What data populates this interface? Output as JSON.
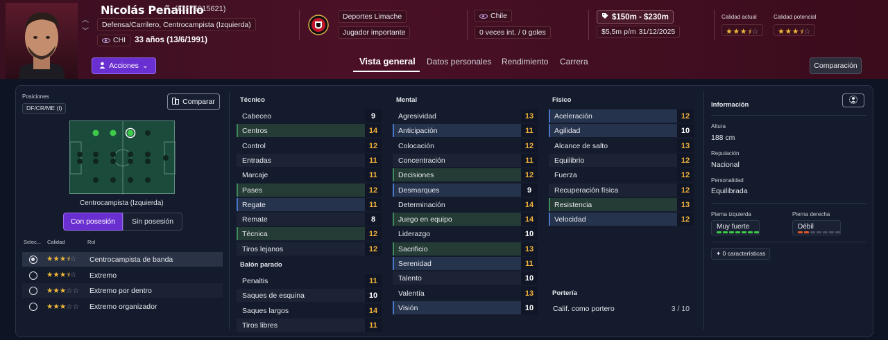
{
  "header": {
    "player_name": "Nicolás Peñailillo",
    "player_id": "(ID: 75015621)",
    "positions": "Defensa/Carrilero, Centrocampista (Izquierda)",
    "nation_code": "CHI",
    "age": "33 años (13/6/1991)",
    "actions_label": "Acciones",
    "club": "Deportes Limache",
    "squad_status": "Jugador importante",
    "nationality": "Chile",
    "caps": "0 veces int. / 0 goles",
    "value": "$150m - $230m",
    "wage": "$5,5m p/m",
    "contract_end": "31/12/2025",
    "current_ability_label": "Calidad actual",
    "current_ability_stars": "3.5",
    "potential_ability_label": "Calidad potencial",
    "potential_ability_stars": "3.5",
    "comparison_label": "Comparación"
  },
  "tabs": [
    {
      "label": "Vista general",
      "active": true
    },
    {
      "label": "Datos personales",
      "active": false
    },
    {
      "label": "Rendimiento",
      "active": false
    },
    {
      "label": "Carrera",
      "active": false
    }
  ],
  "positions_panel": {
    "label": "Posiciones",
    "position_code": "DF/CR/ME (I)",
    "compare_label": "Comparar",
    "pitch_caption": "Centrocampista (Izquierda)",
    "toggle_on": "Con posesión",
    "toggle_off": "Sin posesión",
    "role_headers": {
      "select": "Selec...",
      "quality": "Calidad",
      "role": "Rol"
    },
    "roles": [
      {
        "name": "Centrocampista de banda",
        "stars": 3.5,
        "selected": true
      },
      {
        "name": "Extremo",
        "stars": 3.5,
        "selected": false
      },
      {
        "name": "Extremo por dentro",
        "stars": 3,
        "selected": false
      },
      {
        "name": "Extremo organizador",
        "stars": 3,
        "selected": false
      }
    ]
  },
  "tecnico": {
    "title": "Técnico",
    "attrs": [
      {
        "name": "Cabeceo",
        "value": "9",
        "hl": "none"
      },
      {
        "name": "Centros",
        "value": "14",
        "hl": "green"
      },
      {
        "name": "Control",
        "value": "12",
        "hl": "none"
      },
      {
        "name": "Entradas",
        "value": "11",
        "hl": "none"
      },
      {
        "name": "Marcaje",
        "value": "11",
        "hl": "none"
      },
      {
        "name": "Pases",
        "value": "12",
        "hl": "green"
      },
      {
        "name": "Regate",
        "value": "11",
        "hl": "blue"
      },
      {
        "name": "Remate",
        "value": "8",
        "hl": "none"
      },
      {
        "name": "Técnica",
        "value": "12",
        "hl": "green"
      },
      {
        "name": "Tiros lejanos",
        "value": "12",
        "hl": "none"
      }
    ]
  },
  "balon_parado": {
    "title": "Balón parado",
    "attrs": [
      {
        "name": "Penaltis",
        "value": "11",
        "hl": "none"
      },
      {
        "name": "Saques de esquina",
        "value": "10",
        "hl": "none"
      },
      {
        "name": "Saques largos",
        "value": "14",
        "hl": "none"
      },
      {
        "name": "Tiros libres",
        "value": "11",
        "hl": "none"
      }
    ]
  },
  "mental": {
    "title": "Mental",
    "attrs": [
      {
        "name": "Agresividad",
        "value": "13",
        "hl": "none"
      },
      {
        "name": "Anticipación",
        "value": "11",
        "hl": "blue"
      },
      {
        "name": "Colocación",
        "value": "12",
        "hl": "none"
      },
      {
        "name": "Concentración",
        "value": "11",
        "hl": "none"
      },
      {
        "name": "Decisiones",
        "value": "12",
        "hl": "green"
      },
      {
        "name": "Desmarques",
        "value": "9",
        "hl": "blue"
      },
      {
        "name": "Determinación",
        "value": "14",
        "hl": "none"
      },
      {
        "name": "Juego en equipo",
        "value": "14",
        "hl": "green"
      },
      {
        "name": "Liderazgo",
        "value": "10",
        "hl": "none"
      },
      {
        "name": "Sacrificio",
        "value": "13",
        "hl": "green"
      },
      {
        "name": "Serenidad",
        "value": "11",
        "hl": "blue"
      },
      {
        "name": "Talento",
        "value": "10",
        "hl": "none"
      },
      {
        "name": "Valentía",
        "value": "13",
        "hl": "none"
      },
      {
        "name": "Visión",
        "value": "10",
        "hl": "blue"
      }
    ]
  },
  "fisico": {
    "title": "Físico",
    "attrs": [
      {
        "name": "Aceleración",
        "value": "12",
        "hl": "blue"
      },
      {
        "name": "Agilidad",
        "value": "10",
        "hl": "blue"
      },
      {
        "name": "Alcance de salto",
        "value": "13",
        "hl": "none"
      },
      {
        "name": "Equilibrio",
        "value": "12",
        "hl": "none"
      },
      {
        "name": "Fuerza",
        "value": "12",
        "hl": "none"
      },
      {
        "name": "Recuperación física",
        "value": "12",
        "hl": "none"
      },
      {
        "name": "Resistencia",
        "value": "13",
        "hl": "green"
      },
      {
        "name": "Velocidad",
        "value": "12",
        "hl": "blue"
      }
    ]
  },
  "porteria": {
    "title": "Portería",
    "label": "Calif. como portero",
    "value": "3 / 10"
  },
  "info": {
    "title": "Información",
    "height_label": "Altura",
    "height": "188 cm",
    "reputation_label": "Reputación",
    "reputation": "Nacional",
    "personality_label": "Personalidad",
    "personality": "Equilibrada",
    "left_foot_label": "Pierna izquierda",
    "left_foot": "Muy fuerte",
    "right_foot_label": "Pierna derecha",
    "right_foot": "Débil",
    "traits": "0 características"
  },
  "colors": {
    "accent": "#6a2fd0",
    "star": "#f0b93a",
    "value_orange": "#f2b33a"
  }
}
